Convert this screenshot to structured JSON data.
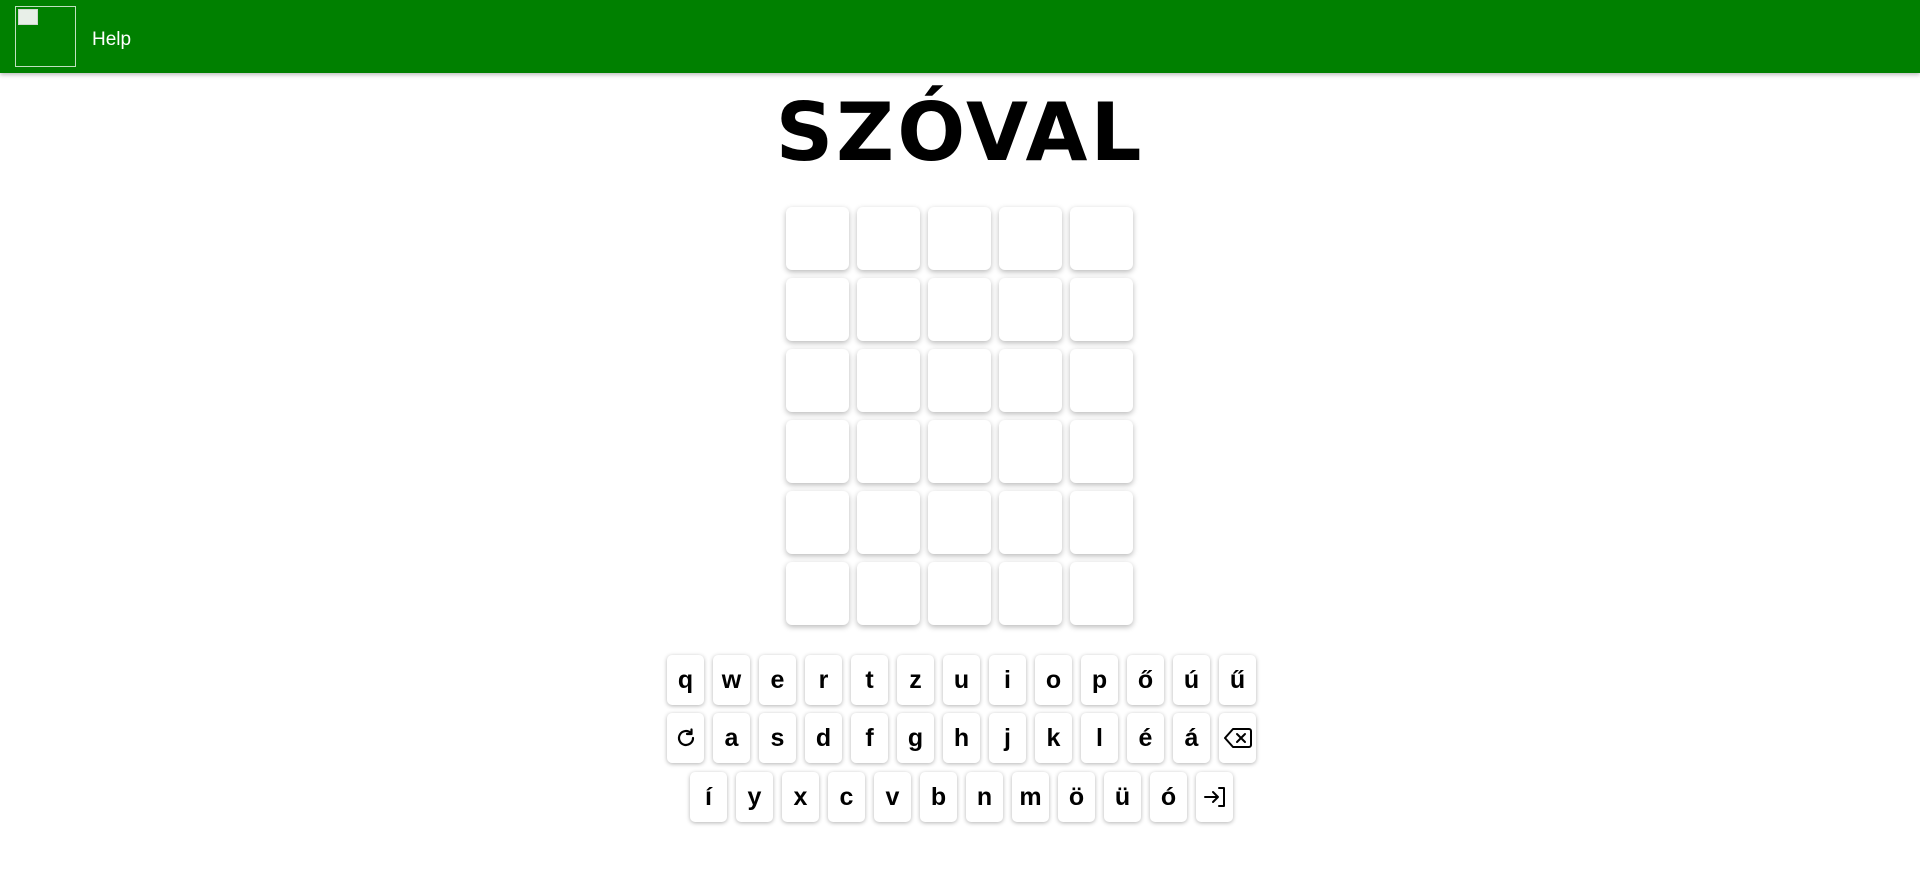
{
  "topbar": {
    "help_label": "Help"
  },
  "title": "SZÓVAL",
  "board": {
    "rows": 6,
    "cols": 5
  },
  "keyboard": {
    "row1": [
      "q",
      "w",
      "e",
      "r",
      "t",
      "z",
      "u",
      "i",
      "o",
      "p",
      "ő",
      "ú",
      "ű"
    ],
    "row2": [
      "refresh-icon",
      "a",
      "s",
      "d",
      "f",
      "g",
      "h",
      "j",
      "k",
      "l",
      "é",
      "á",
      "backspace-icon"
    ],
    "row3": [
      "í",
      "y",
      "x",
      "c",
      "v",
      "b",
      "n",
      "m",
      "ö",
      "ü",
      "ó",
      "enter-icon"
    ]
  },
  "colors": {
    "header_bg": "#008000",
    "page_bg": "#ffffff"
  }
}
